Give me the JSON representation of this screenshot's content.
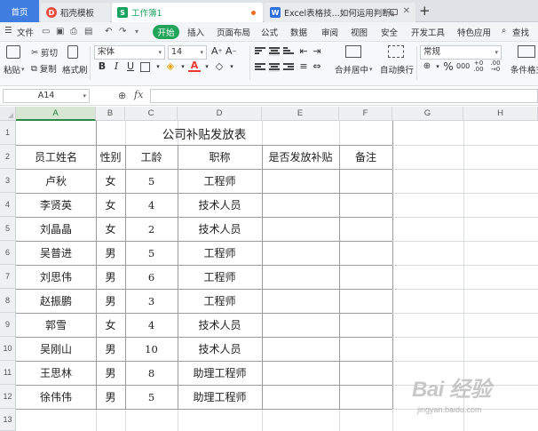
{
  "tabs": {
    "home": "首页",
    "template": "稻壳模板",
    "book": "工作簿1",
    "excel": "Excel表格技...如何运用判断函数"
  },
  "menu": {
    "file": "文件",
    "start": "开始",
    "items": [
      "插入",
      "页面布局",
      "公式",
      "数据",
      "审阅",
      "视图",
      "安全",
      "开发工具",
      "特色应用"
    ],
    "search": "查找"
  },
  "ribbon": {
    "paste": "粘贴",
    "cut": "剪切",
    "copy": "复制",
    "format_painter": "格式刷",
    "font_name": "宋体",
    "font_size": "14",
    "merge_center": "合并居中",
    "wrap_text": "自动换行",
    "number_format": "常规",
    "cond_format": "条件格式",
    "bold": "B",
    "italic": "I",
    "underline": "U"
  },
  "formula_bar": {
    "cell_ref": "A14",
    "fx": "fx",
    "value": ""
  },
  "sheet": {
    "columns": [
      "A",
      "B",
      "C",
      "D",
      "E",
      "F",
      "G",
      "H"
    ],
    "active_column": "A",
    "rows": [
      "1",
      "2",
      "3",
      "4",
      "5",
      "6",
      "7",
      "8",
      "9",
      "10",
      "11",
      "12",
      "13"
    ],
    "title": "公司补贴发放表",
    "headers": [
      "员工姓名",
      "性别",
      "工龄",
      "职称",
      "是否发放补贴",
      "备注"
    ],
    "data": [
      [
        "卢秋",
        "女",
        "5",
        "工程师",
        "",
        ""
      ],
      [
        "李贤英",
        "女",
        "4",
        "技术人员",
        "",
        ""
      ],
      [
        "刘晶晶",
        "女",
        "2",
        "技术人员",
        "",
        ""
      ],
      [
        "吴普进",
        "男",
        "5",
        "工程师",
        "",
        ""
      ],
      [
        "刘思伟",
        "男",
        "6",
        "工程师",
        "",
        ""
      ],
      [
        "赵振鹏",
        "男",
        "3",
        "工程师",
        "",
        ""
      ],
      [
        "郭雪",
        "女",
        "4",
        "技术人员",
        "",
        ""
      ],
      [
        "吴刚山",
        "男",
        "10",
        "技术人员",
        "",
        ""
      ],
      [
        "王思林",
        "男",
        "8",
        "助理工程师",
        "",
        ""
      ],
      [
        "徐伟伟",
        "男",
        "5",
        "助理工程师",
        "",
        ""
      ]
    ]
  },
  "watermark": {
    "brand": "Bai 经验",
    "domain": "jingyan.baidu.com"
  },
  "colors": {
    "home_tab": "#3f7de0",
    "start_button": "#20a55a",
    "active_header": "#2c8a45",
    "table_border": "#9c9c9c"
  }
}
